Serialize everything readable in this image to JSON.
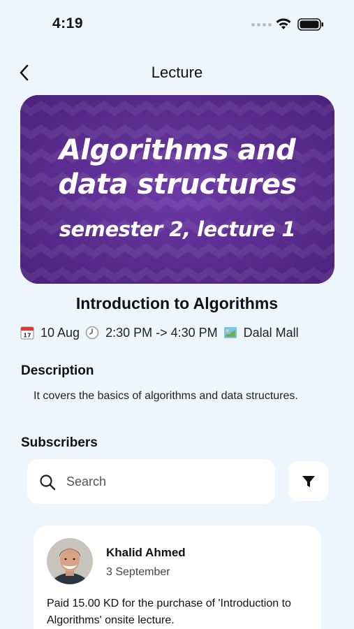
{
  "status_bar": {
    "time": "4:19"
  },
  "nav": {
    "title": "Lecture",
    "back_icon": "chevron-left-icon"
  },
  "hero": {
    "line1": "Algorithms and",
    "line2": "data structures",
    "line3": "semester 2, lecture 1",
    "background_color": "#5b2a8e"
  },
  "lecture": {
    "title": "Introduction to Algorithms",
    "date": "10 Aug",
    "time_range": "2:30 PM -> 4:30 PM",
    "location": "Dalal Mall",
    "date_icon": "calendar-icon",
    "time_icon": "clock-icon",
    "location_icon": "map-icon"
  },
  "description": {
    "label": "Description",
    "text": "It covers the basics of algorithms and data structures."
  },
  "subscribers": {
    "label": "Subscribers",
    "search_placeholder": "Search",
    "filter_icon": "filter-icon",
    "items": [
      {
        "name": "Khalid Ahmed",
        "date": "3 September",
        "message": "Paid 15.00 KD for the purchase of 'Introduction to Algorithms' onsite lecture."
      }
    ]
  }
}
